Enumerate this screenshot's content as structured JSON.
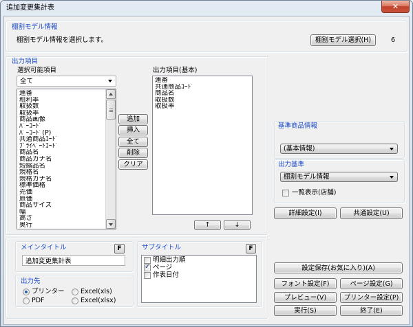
{
  "window": {
    "title": "追加変更集計表"
  },
  "colors": {
    "accent": "#1e4fc9",
    "close_button": "#c2412a"
  },
  "icons": {
    "close": "close-icon",
    "dropdown": "chevron-down-icon",
    "scroll_up": "scroll-up-icon",
    "scroll_down": "scroll-down-icon",
    "check": "check-icon",
    "radio": "radio-dot-icon"
  },
  "model_info": {
    "group_label": "棚割モデル情報",
    "description": "棚割モデル情報を選択します。",
    "select_button": "棚割モデル選択(H)",
    "value": "6"
  },
  "output_items": {
    "group_label": "出力項目",
    "available_label": "選択可能項目",
    "filter_selected": "全て",
    "available_items": [
      "連番",
      "粗利率",
      "取扱数",
      "取扱率",
      "商品画像",
      "ﾊﾞｰｺｰﾄﾞ",
      "ﾊﾞｰｺｰﾄﾞ(P)",
      "共通商品ｺｰﾄﾞ",
      "ﾌﾟﾗｲﾍﾞｰﾄｺｰﾄﾞ",
      "商品名",
      "商品カナ名",
      "短縮品名",
      "規格名",
      "規格カナ名",
      "標準価格",
      "売価",
      "原価",
      "商品サイズ",
      "幅",
      "高さ",
      "奥行"
    ],
    "buttons": {
      "add": "追加",
      "insert": "挿入",
      "all": "全て",
      "delete": "削除",
      "clear": "クリア"
    },
    "selected_label": "出力項目(基本)",
    "selected_items": [
      "連番",
      "共通商品ｺｰﾄﾞ",
      "商品名",
      "取扱数",
      "取扱率"
    ],
    "move_up": "↑",
    "move_down": "↓"
  },
  "base_product": {
    "group_label": "基準商品情報",
    "selected": "(基本情報)"
  },
  "output_basis": {
    "group_label": "出力基準",
    "selected": "棚割モデル情報",
    "list_display_label": "一覧表示(店舗)",
    "list_display_checked": false
  },
  "settings": {
    "detail_button": "詳細設定(I)",
    "common_button": "共通設定(U)"
  },
  "main_title": {
    "group_label": "メインタイトル",
    "font_button": "F",
    "value": "追加変更集計表"
  },
  "sub_title": {
    "group_label": "サブタイトル",
    "font_button": "F",
    "items": [
      {
        "label": "明細出力順",
        "checked": false
      },
      {
        "label": "ページ",
        "checked": true
      },
      {
        "label": "作表日付",
        "checked": false
      }
    ]
  },
  "output_dest": {
    "group_label": "出力先",
    "options": [
      {
        "label": "プリンター",
        "selected": true
      },
      {
        "label": "PDF",
        "selected": false
      },
      {
        "label": "Excel(xls)",
        "selected": false
      },
      {
        "label": "Excel(xlsx)",
        "selected": false
      }
    ]
  },
  "actions": {
    "save_favorite": "設定保存(お気に入り)(A)",
    "font": "フォント設定(F)",
    "page": "ページ設定(G)",
    "preview": "プレビュー(V)",
    "printer": "プリンター設定(P)",
    "run": "実行(S)",
    "exit": "終了(E)"
  }
}
